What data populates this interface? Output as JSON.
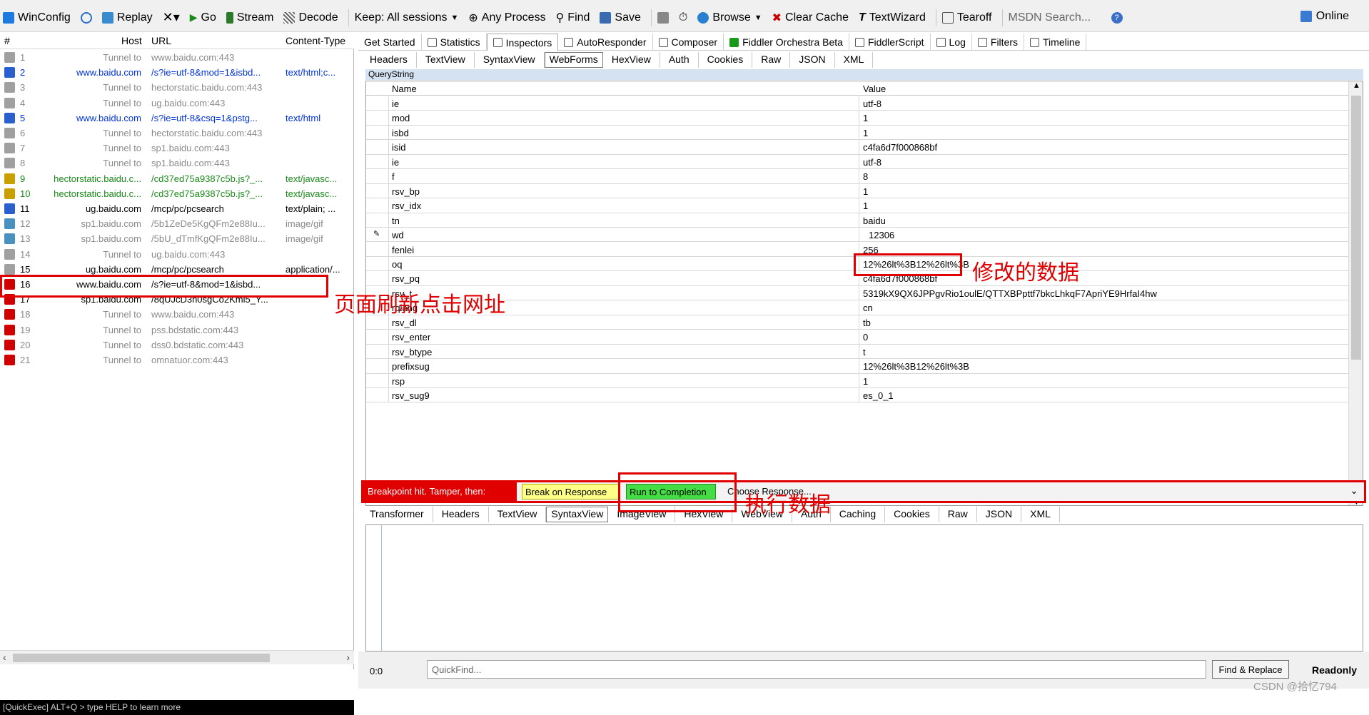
{
  "toolbar": {
    "items": [
      {
        "label": "WinConfig",
        "icon": "windows-icon"
      },
      {
        "label": "",
        "icon": "chat-icon"
      },
      {
        "label": "Replay",
        "icon": "replay-icon"
      },
      {
        "label": "",
        "icon": "close-icon"
      },
      {
        "label": "Go",
        "icon": "play-icon"
      },
      {
        "label": "Stream",
        "icon": "stream-icon"
      },
      {
        "label": "Decode",
        "icon": "decode-icon"
      }
    ],
    "keep": "Keep: All sessions",
    "any_process": "Any Process",
    "find": "Find",
    "save": "Save",
    "browse": "Browse",
    "clear_cache": "Clear Cache",
    "text_wizard": "TextWizard",
    "tearoff": "Tearoff",
    "search_placeholder": "MSDN Search...",
    "online": "Online"
  },
  "sessions": {
    "columns": {
      "num": "#",
      "host": "Host",
      "url": "URL",
      "content_type": "Content-Type"
    },
    "rows": [
      {
        "num": "1",
        "host": "Tunnel to",
        "url": "www.baidu.com:443",
        "ct": "",
        "color": "grey",
        "icon": "lock-icon"
      },
      {
        "num": "2",
        "host": "www.baidu.com",
        "url": "/s?ie=utf-8&mod=1&isbd...",
        "ct": "text/html;c...",
        "color": "blue",
        "icon": "html-icon"
      },
      {
        "num": "3",
        "host": "Tunnel to",
        "url": "hectorstatic.baidu.com:443",
        "ct": "",
        "color": "grey",
        "icon": "lock-icon"
      },
      {
        "num": "4",
        "host": "Tunnel to",
        "url": "ug.baidu.com:443",
        "ct": "",
        "color": "grey",
        "icon": "lock-icon"
      },
      {
        "num": "5",
        "host": "www.baidu.com",
        "url": "/s?ie=utf-8&csq=1&pstg...",
        "ct": "text/html",
        "color": "blue",
        "icon": "html-icon"
      },
      {
        "num": "6",
        "host": "Tunnel to",
        "url": "hectorstatic.baidu.com:443",
        "ct": "",
        "color": "grey",
        "icon": "lock-icon"
      },
      {
        "num": "7",
        "host": "Tunnel to",
        "url": "sp1.baidu.com:443",
        "ct": "",
        "color": "grey",
        "icon": "lock-icon"
      },
      {
        "num": "8",
        "host": "Tunnel to",
        "url": "sp1.baidu.com:443",
        "ct": "",
        "color": "grey",
        "icon": "lock-icon"
      },
      {
        "num": "9",
        "host": "hectorstatic.baidu.c...",
        "url": "/cd37ed75a9387c5b.js?_...",
        "ct": "text/javasc...",
        "color": "green",
        "icon": "script-icon"
      },
      {
        "num": "10",
        "host": "hectorstatic.baidu.c...",
        "url": "/cd37ed75a9387c5b.js?_...",
        "ct": "text/javasc...",
        "color": "green",
        "icon": "script-icon"
      },
      {
        "num": "11",
        "host": "ug.baidu.com",
        "url": "/mcp/pc/pcsearch",
        "ct": "text/plain; ...",
        "color": "black",
        "icon": "info-icon"
      },
      {
        "num": "12",
        "host": "sp1.baidu.com",
        "url": "/5b1ZeDe5KgQFm2e88Iu...",
        "ct": "image/gif",
        "color": "grey",
        "icon": "image-icon"
      },
      {
        "num": "13",
        "host": "sp1.baidu.com",
        "url": "/5bU_dTmfKgQFm2e88Iu...",
        "ct": "image/gif",
        "color": "grey",
        "icon": "image-icon"
      },
      {
        "num": "14",
        "host": "Tunnel to",
        "url": "ug.baidu.com:443",
        "ct": "",
        "color": "grey",
        "icon": "lock-icon"
      },
      {
        "num": "15",
        "host": "ug.baidu.com",
        "url": "/mcp/pc/pcsearch",
        "ct": "application/...",
        "color": "black",
        "icon": "lock-icon"
      },
      {
        "num": "16",
        "host": "www.baidu.com",
        "url": "/s?ie=utf-8&mod=1&isbd...",
        "ct": "",
        "color": "black",
        "icon": "breakpoint-icon"
      },
      {
        "num": "17",
        "host": "sp1.baidu.com",
        "url": "/8qUJcD3n0sgCo2Kml5_Y...",
        "ct": "",
        "color": "black",
        "icon": "breakpoint-icon"
      },
      {
        "num": "18",
        "host": "Tunnel to",
        "url": "www.baidu.com:443",
        "ct": "",
        "color": "grey",
        "icon": "breakpoint-icon"
      },
      {
        "num": "19",
        "host": "Tunnel to",
        "url": "pss.bdstatic.com:443",
        "ct": "",
        "color": "grey",
        "icon": "breakpoint-icon"
      },
      {
        "num": "20",
        "host": "Tunnel to",
        "url": "dss0.bdstatic.com:443",
        "ct": "",
        "color": "grey",
        "icon": "breakpoint-icon"
      },
      {
        "num": "21",
        "host": "Tunnel to",
        "url": "omnatuor.com:443",
        "ct": "",
        "color": "grey",
        "icon": "breakpoint-icon"
      }
    ],
    "quickexec": "[QuickExec] ALT+Q > type HELP to learn more"
  },
  "main_tabs": [
    {
      "label": "Get Started",
      "icon": ""
    },
    {
      "label": "Statistics",
      "icon": "stopwatch-icon"
    },
    {
      "label": "Inspectors",
      "icon": "inspect-icon",
      "active": true
    },
    {
      "label": "AutoResponder",
      "icon": "lightning-icon"
    },
    {
      "label": "Composer",
      "icon": "composer-icon"
    },
    {
      "label": "Fiddler Orchestra Beta",
      "icon": "fo-icon"
    },
    {
      "label": "FiddlerScript",
      "icon": "script-icon"
    },
    {
      "label": "Log",
      "icon": "log-icon"
    },
    {
      "label": "Filters",
      "icon": "checkbox-icon"
    },
    {
      "label": "Timeline",
      "icon": "timeline-icon"
    }
  ],
  "request_tabs": [
    "Headers",
    "TextView",
    "SyntaxView",
    "WebForms",
    "HexView",
    "Auth",
    "Cookies",
    "Raw",
    "JSON",
    "XML"
  ],
  "request_active": "WebForms",
  "querystring": {
    "label": "QueryString",
    "name_header": "Name",
    "value_header": "Value",
    "rows": [
      {
        "name": "ie",
        "value": "utf-8"
      },
      {
        "name": "mod",
        "value": "1"
      },
      {
        "name": "isbd",
        "value": "1"
      },
      {
        "name": "isid",
        "value": "c4fa6d7f000868bf"
      },
      {
        "name": "ie",
        "value": "utf-8"
      },
      {
        "name": "f",
        "value": "8"
      },
      {
        "name": "rsv_bp",
        "value": "1"
      },
      {
        "name": "rsv_idx",
        "value": "1"
      },
      {
        "name": "tn",
        "value": "baidu"
      },
      {
        "name": "wd",
        "value": "12306"
      },
      {
        "name": "fenlei",
        "value": "256"
      },
      {
        "name": "oq",
        "value": "12%26lt%3B12%26lt%3B"
      },
      {
        "name": "rsv_pq",
        "value": "c4fa6d7f000868bf"
      },
      {
        "name": "rsv_t",
        "value": "5319kX9QX6JPPgvRio1oulE/QTTXBPpttf7bkcLhkqF7ApriYE9HrfaI4hw"
      },
      {
        "name": "rqlang",
        "value": "cn"
      },
      {
        "name": "rsv_dl",
        "value": "tb"
      },
      {
        "name": "rsv_enter",
        "value": "0"
      },
      {
        "name": "rsv_btype",
        "value": "t"
      },
      {
        "name": "prefixsug",
        "value": "12%26lt%3B12%26lt%3B"
      },
      {
        "name": "rsp",
        "value": "1"
      },
      {
        "name": "rsv_sug9",
        "value": "es_0_1"
      }
    ]
  },
  "breakpoint": {
    "label": "Breakpoint hit. Tamper, then:",
    "break_on_response": "Break on Response",
    "run_to_completion": "Run to Completion",
    "choose_response": "Choose Response..."
  },
  "response_tabs": [
    "Transformer",
    "Headers",
    "TextView",
    "SyntaxView",
    "ImageView",
    "HexView",
    "WebView",
    "Auth",
    "Caching",
    "Cookies",
    "Raw",
    "JSON",
    "XML"
  ],
  "response_active": "SyntaxView",
  "bottom": {
    "position": "0:0",
    "quickfind_placeholder": "QuickFind...",
    "find_replace": "Find & Replace",
    "readonly": "Readonly",
    "watermark": "CSDN @拾忆794"
  },
  "annotations": {
    "modified": "修改的数据",
    "refresh": "页面刷新点击网址",
    "execute": "执行数据"
  },
  "colors": {
    "annotation_red": "#e00000",
    "host_blue": "#0033dd",
    "host_green": "#1a8a1a",
    "muted_grey": "#8a8a8a",
    "run_green": "#44dd44",
    "break_yellow": "#ffff88"
  }
}
